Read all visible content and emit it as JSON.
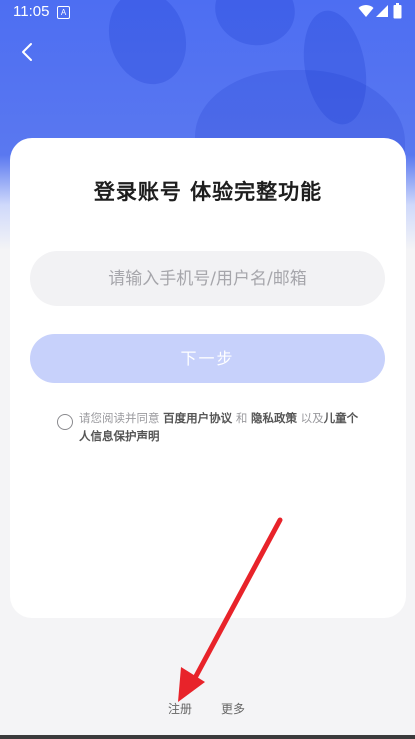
{
  "status_bar": {
    "time": "11:05",
    "notification_letter": "A"
  },
  "card": {
    "title": "登录账号 体验完整功能",
    "account_input": {
      "value": "",
      "placeholder": "请输入手机号/用户名/邮箱"
    },
    "next_button_label": "下一步",
    "agreement": {
      "prefix": "请您阅读并同意",
      "user_agreement": "百度用户协议",
      "and": "和",
      "privacy_policy": "隐私政策",
      "and_also": "以及",
      "child_privacy": "儿童个人信息保护声明"
    }
  },
  "footer": {
    "register_label": "注册",
    "more_label": "更多"
  },
  "colors": {
    "primary": "#4d6ef2",
    "button_disabled": "#c7d1fb",
    "annotation_arrow": "#e8232a"
  }
}
